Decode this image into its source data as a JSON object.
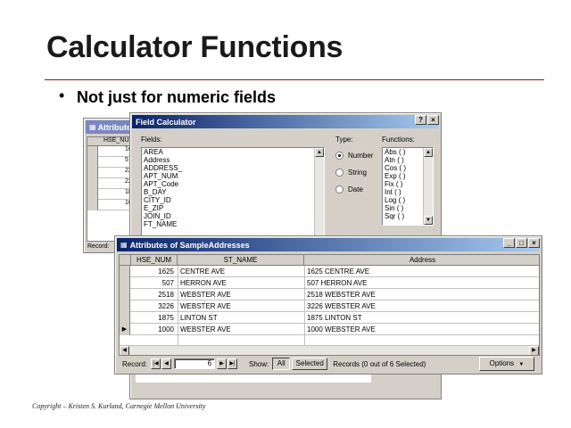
{
  "slide": {
    "title": "Calculator Functions",
    "bullet": "Not just for numeric fields",
    "footer": "Copyright – Kristen S. Kurland, Carnegie Mellon University"
  },
  "bg_window": {
    "title": "Attributes",
    "column": "HSE_NUM",
    "rows": [
      "16",
      "5",
      "22",
      "22",
      "18",
      "10"
    ],
    "footer_label": "Record:"
  },
  "field_calc": {
    "title": "Field Calculator",
    "fields_label": "Fields:",
    "fields": [
      "AREA",
      "Address",
      "ADDRESS_",
      "APT_NUM",
      "APT_Code",
      "B_DAY",
      "CITY_ID",
      "E_ZIP",
      "JOIN_ID",
      "FT_NAME"
    ],
    "type_label": "Type:",
    "types": [
      {
        "label": "Number",
        "selected": true
      },
      {
        "label": "String",
        "selected": false
      },
      {
        "label": "Date",
        "selected": false
      }
    ],
    "functions_label": "Functions:",
    "functions": [
      "Abs ( )",
      "Atn ( )",
      "Cos ( )",
      "Exp ( )",
      "Fix ( )",
      "Int ( )",
      "Log ( )",
      "Sin ( )",
      "Sqr ( )"
    ]
  },
  "attr_window": {
    "title": "Attributes of SampleAddresses",
    "columns": [
      "HSE_NUM",
      "ST_NAME",
      "Address"
    ],
    "rows": [
      {
        "hse": "1625",
        "st": "CENTRE AVE",
        "addr": "1625 CENTRE AVE"
      },
      {
        "hse": "507",
        "st": "HERRON AVE",
        "addr": "507 HERRON AVE"
      },
      {
        "hse": "2518",
        "st": "WEBSTER AVE",
        "addr": "2518 WEBSTER AVE"
      },
      {
        "hse": "3226",
        "st": "WEBSTER AVE",
        "addr": "3226 WEBSTER AVE"
      },
      {
        "hse": "1875",
        "st": "LINTON ST",
        "addr": "1875 LINTON ST"
      },
      {
        "hse": "1000",
        "st": "WEBSTER AVE",
        "addr": "1000 WEBSTER AVE"
      }
    ],
    "record_label": "Record:",
    "record_value": "6",
    "show_label": "Show:",
    "all_label": "All",
    "selected_label": "Selected",
    "records_status": "Records (0 out of 6 Selected)",
    "options_label": "Options"
  },
  "colors": {
    "title_active": "#0a246a",
    "title_inactive": "#7a86c0",
    "rule": "#7a1c1c"
  }
}
